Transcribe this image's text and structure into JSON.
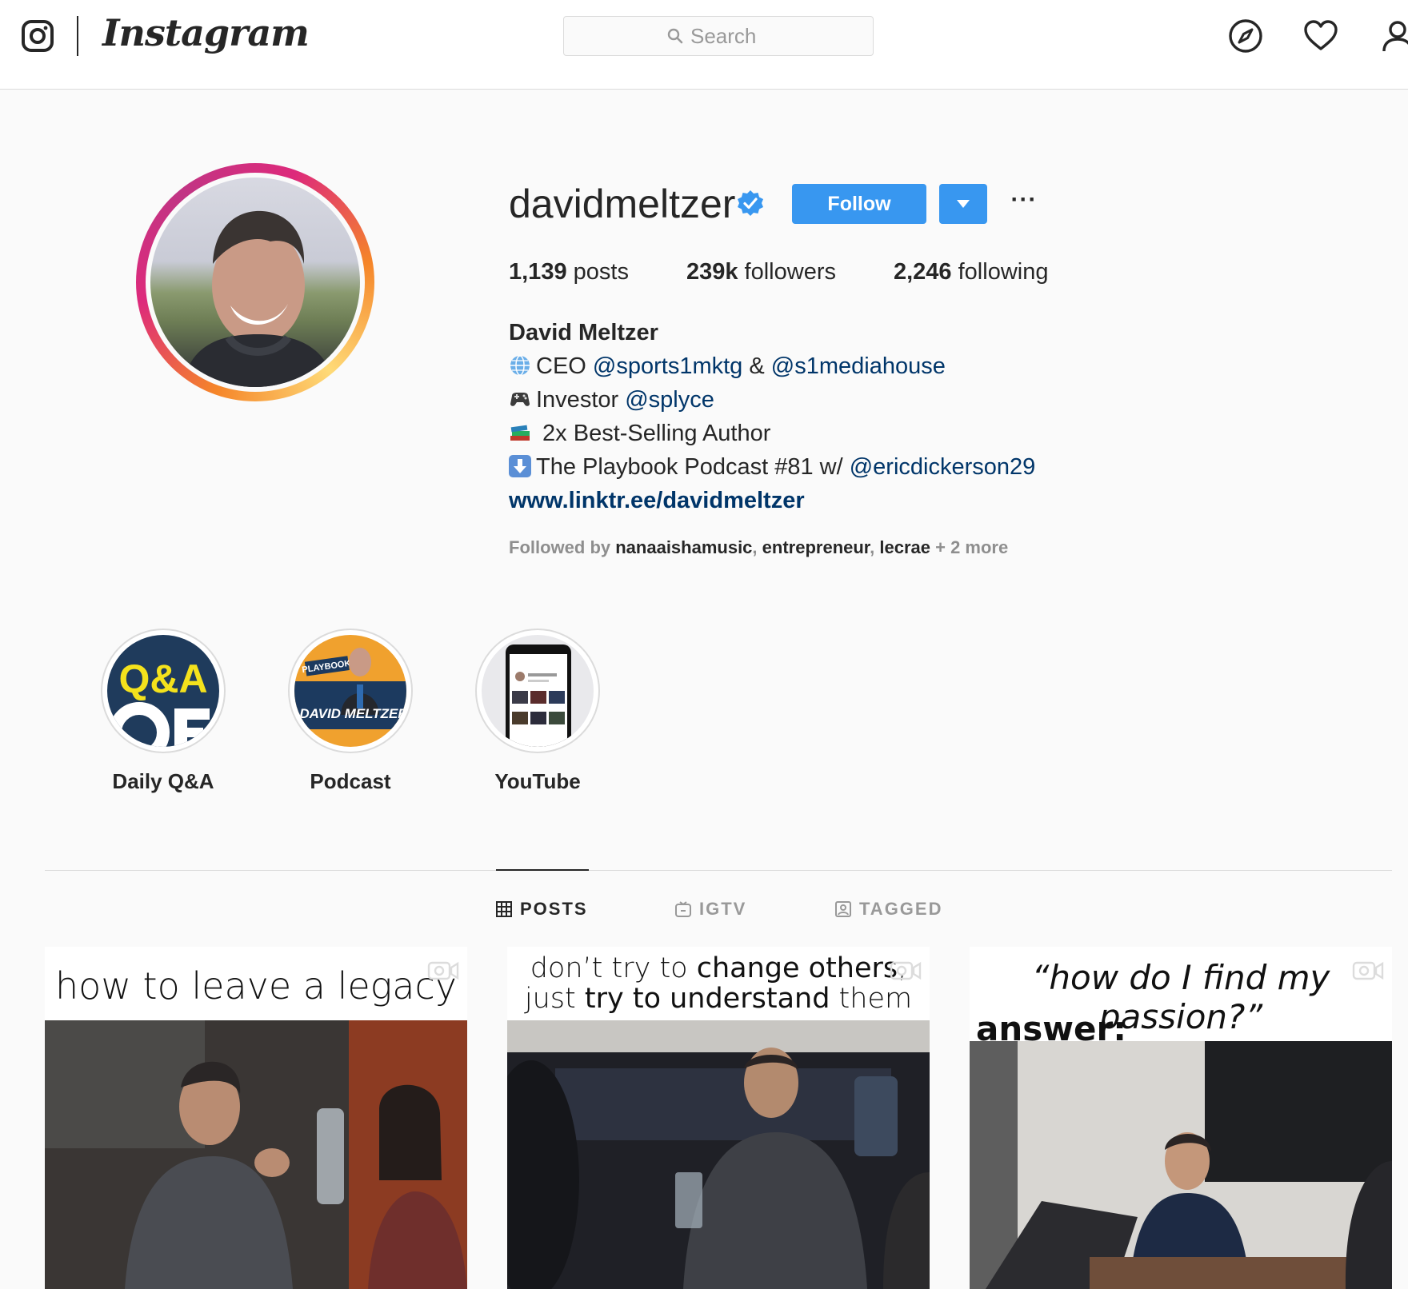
{
  "header": {
    "wordmark": "Instagram",
    "search_placeholder": "Search"
  },
  "profile": {
    "username": "davidmeltzer",
    "follow_label": "Follow",
    "more_label": "···",
    "stats": [
      {
        "value": "1,139",
        "label": "posts"
      },
      {
        "value": "239k",
        "label": "followers"
      },
      {
        "value": "2,246",
        "label": "following"
      }
    ],
    "full_name": "David Meltzer",
    "bio": {
      "line1": {
        "prefix": "CEO ",
        "mention1": "@sports1mktg",
        "middle": " & ",
        "mention2": "@s1mediahouse"
      },
      "line2": {
        "prefix": "Investor ",
        "mention1": "@splyce"
      },
      "line3": {
        "prefix": " 2x Best-Selling Author"
      },
      "line4": {
        "prefix": "The Playbook Podcast #81 w/ ",
        "mention1": "@ericdickerson29"
      }
    },
    "link": "www.linktr.ee/davidmeltzer",
    "followed_by": {
      "prefix": "Followed by ",
      "names": [
        "nanaaishamusic",
        "entrepreneur",
        "lecrae"
      ],
      "sep": ", ",
      "suffix": " + 2 more"
    }
  },
  "highlights": [
    {
      "label": "Daily Q&A",
      "art_text": "Q&A"
    },
    {
      "label": "Podcast",
      "art_text": "DAVID MELTZER",
      "art_sub": "PLAYBOOK"
    },
    {
      "label": "YouTube"
    }
  ],
  "tabs": [
    {
      "label": "POSTS",
      "active": true
    },
    {
      "label": "IGTV",
      "active": false
    },
    {
      "label": "TAGGED",
      "active": false
    }
  ],
  "posts": [
    {
      "caption": "how to leave a legacy"
    },
    {
      "caption_parts": [
        "don’t try to ",
        "change others",
        ",",
        "just ",
        "try to understand",
        " them"
      ]
    },
    {
      "caption_line1": "“how do I find my passion?”",
      "caption_line2": "answer:"
    }
  ],
  "colors": {
    "accent": "#3897f0",
    "mention": "#003569",
    "muted": "#8e8e8e",
    "border": "#dbdbdb"
  }
}
